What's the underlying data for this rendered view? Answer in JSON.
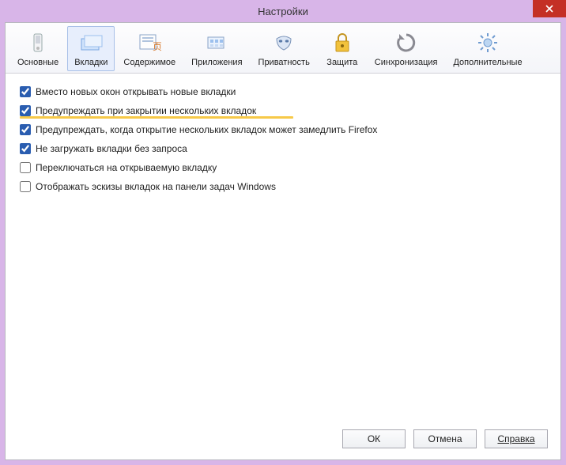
{
  "window": {
    "title": "Настройки"
  },
  "toolbar": {
    "items": [
      {
        "id": "general",
        "label": "Основные",
        "icon": "switch-icon",
        "active": false
      },
      {
        "id": "tabs",
        "label": "Вкладки",
        "icon": "tabs-icon",
        "active": true
      },
      {
        "id": "content",
        "label": "Содержимое",
        "icon": "content-icon",
        "active": false
      },
      {
        "id": "apps",
        "label": "Приложения",
        "icon": "apps-icon",
        "active": false
      },
      {
        "id": "privacy",
        "label": "Приватность",
        "icon": "mask-icon",
        "active": false
      },
      {
        "id": "security",
        "label": "Защита",
        "icon": "lock-icon",
        "active": false
      },
      {
        "id": "sync",
        "label": "Синхронизация",
        "icon": "sync-icon",
        "active": false
      },
      {
        "id": "advanced",
        "label": "Дополнительные",
        "icon": "gear-icon",
        "active": false
      }
    ]
  },
  "options": [
    {
      "checked": true,
      "label": "Вместо новых окон открывать новые вкладки",
      "highlighted": false
    },
    {
      "checked": true,
      "label": "Предупреждать при закрытии нескольких вкладок",
      "highlighted": true
    },
    {
      "checked": true,
      "label": "Предупреждать, когда открытие нескольких вкладок может замедлить Firefox",
      "highlighted": false
    },
    {
      "checked": true,
      "label": "Не загружать вкладки без запроса",
      "highlighted": false
    },
    {
      "checked": false,
      "label": "Переключаться на открываемую вкладку",
      "highlighted": false
    },
    {
      "checked": false,
      "label": "Отображать эскизы вкладок на панели задач Windows",
      "highlighted": false
    }
  ],
  "buttons": {
    "ok": "ОК",
    "cancel": "Отмена",
    "help": "Справка"
  }
}
